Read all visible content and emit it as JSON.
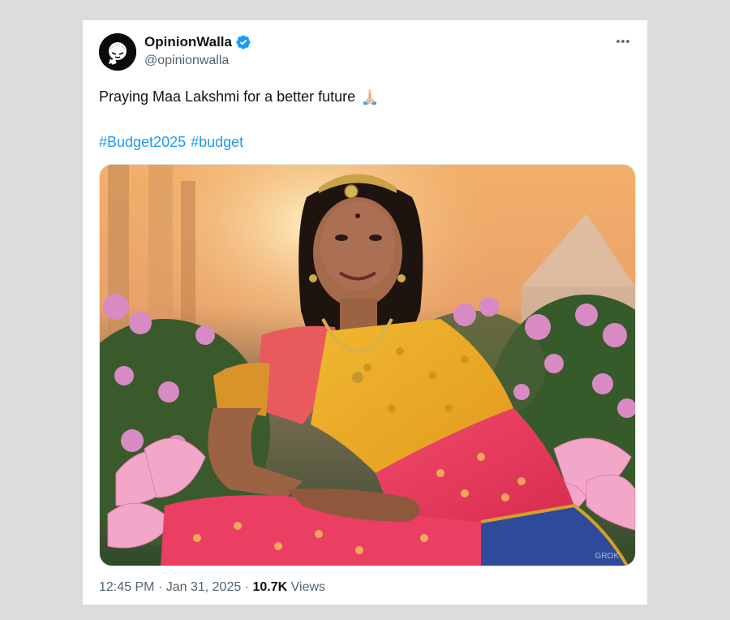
{
  "tweet": {
    "display_name": "OpinionWalla",
    "handle": "@opinionwalla",
    "verified": true,
    "text": "Praying Maa Lakshmi for a better future",
    "text_emoji": "folded-hands-emoji",
    "hashtags": [
      "#Budget2025",
      "#budget"
    ],
    "image_alt": "Woman in saree seated on lotus",
    "watermark": "GROK",
    "time": "12:45 PM",
    "date": "Jan 31, 2025",
    "views_count": "10.7K",
    "views_label": "Views",
    "separator": "·"
  },
  "colors": {
    "link": "#1d9bf0",
    "verified": "#1d9bf0",
    "text": "#0f1419",
    "secondary": "#536471",
    "backdrop": "#dcdcdc"
  },
  "icons": {
    "more": "more-horizontal-icon",
    "verified": "verified-badge-icon"
  }
}
